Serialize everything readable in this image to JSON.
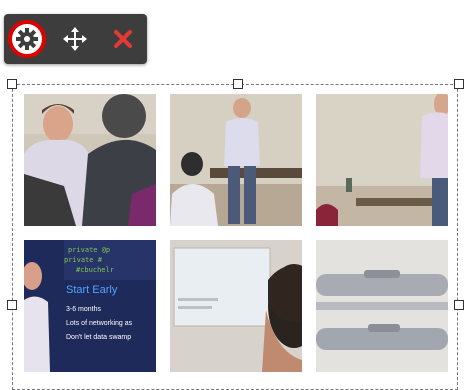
{
  "toolbar": {
    "buttons": [
      {
        "name": "settings",
        "icon": "gear-icon",
        "active": true
      },
      {
        "name": "move",
        "icon": "move-icon"
      },
      {
        "name": "remove",
        "icon": "close-icon"
      }
    ],
    "active_ring_color": "#e00000",
    "remove_color": "#e53935"
  },
  "gallery": {
    "tiles": [
      {
        "subject": "man-speaking-closeup"
      },
      {
        "subject": "presenter-at-room"
      },
      {
        "subject": "presenter-side"
      },
      {
        "subject": "slide-presentation",
        "slide_title": "Start Early",
        "slide_lines": [
          "3-6 months",
          "Lots of networking as",
          "Don't let data swamp"
        ]
      },
      {
        "subject": "screen-and-listener"
      },
      {
        "subject": "grey-objects"
      }
    ]
  }
}
